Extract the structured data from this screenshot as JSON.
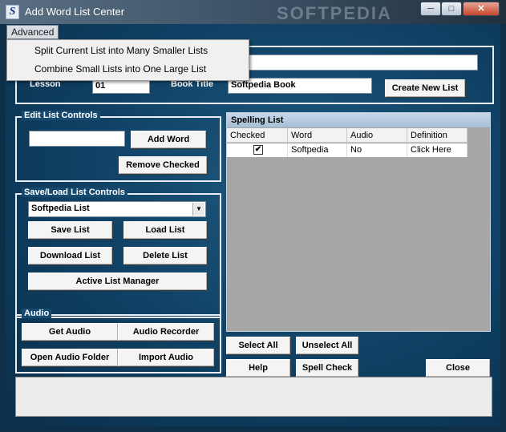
{
  "window": {
    "title": "Add Word List Center",
    "watermark": "SOFTPEDIA",
    "min_glyph": "─",
    "max_glyph": "□",
    "close_glyph": "✕"
  },
  "app_icon": {
    "glyph": "S",
    "icon": "app-icon"
  },
  "menu": {
    "advanced_label": "Advanced",
    "items": [
      "Split Current List into Many Smaller Lists",
      "Combine Small Lists into One Large List"
    ]
  },
  "list_info": {
    "lesson_label": "Lesson",
    "lesson_value": "01",
    "book_title_label": "Book Title",
    "book_title_value": "Softpedia Book",
    "list_name_value": "",
    "create_new_list": "Create New List"
  },
  "edit_controls": {
    "title": "Edit List Controls",
    "word_input_value": "",
    "add_word": "Add Word",
    "remove_checked": "Remove Checked"
  },
  "save_load": {
    "title": "Save/Load List Controls",
    "selected_list": "Softpedia List",
    "save_list": "Save List",
    "load_list": "Load List",
    "download_list": "Download List",
    "delete_list": "Delete List",
    "active_list_manager": "Active List Manager"
  },
  "audio": {
    "title": "Audio",
    "get_audio": "Get Audio",
    "audio_recorder": "Audio Recorder",
    "open_audio_folder": "Open Audio Folder",
    "import_audio": "Import Audio"
  },
  "spelling_list": {
    "title": "Spelling List",
    "columns": [
      "Checked",
      "Word",
      "Audio",
      "Definition"
    ],
    "rows": [
      {
        "checked": true,
        "check_glyph": "✔",
        "word": "Softpedia",
        "audio": "No",
        "definition": "Click Here"
      }
    ]
  },
  "actions": {
    "select_all": "Select All",
    "unselect_all": "Unselect All",
    "help": "Help",
    "spell_check": "Spell Check",
    "close": "Close"
  },
  "colors": {
    "background": "#0f3f62",
    "panel_border": "#e8eef3",
    "button_face": "#f4f4f4",
    "list_background": "#a7a7a7"
  }
}
